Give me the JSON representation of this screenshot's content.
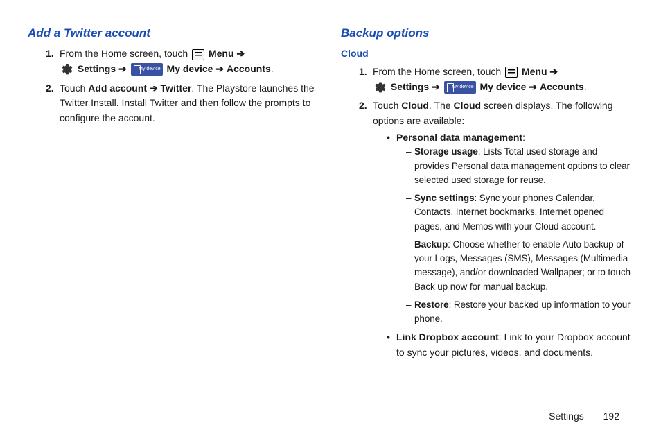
{
  "left": {
    "title": "Add a Twitter account",
    "step1_a": "From the Home screen, touch ",
    "menu": "Menu",
    "arrow": "➔",
    "settings": "Settings",
    "mydevice": "My device",
    "accounts": "Accounts",
    "step2_a": "Touch ",
    "step2_b": "Add account ➔ Twitter",
    "step2_c": ". The Playstore launches the Twitter Install. Install Twitter and then follow the prompts to configure the account."
  },
  "right": {
    "title": "Backup options",
    "subhead": "Cloud",
    "step1_a": "From the Home screen, touch ",
    "menu": "Menu",
    "arrow": "➔",
    "settings": "Settings",
    "mydevice": "My device",
    "accounts": "Accounts",
    "step2_a": "Touch ",
    "step2_b": "Cloud",
    "step2_c": ". The ",
    "step2_d": "Cloud",
    "step2_e": " screen displays. The following options are available:",
    "pdm": "Personal data management",
    "storage_b": "Storage usage",
    "storage_t": ": Lists Total used storage and provides Personal data management options to clear selected used storage for reuse.",
    "sync_b": "Sync settings",
    "sync_t": ": Sync your phones Calendar, Contacts, Internet bookmarks, Internet opened pages, and Memos with your Cloud account.",
    "backup_b": "Backup",
    "backup_t": ": Choose whether to enable Auto backup of your Logs, Messages (SMS), Messages (Multimedia message), and/or downloaded Wallpaper; or to touch Back up now for manual backup.",
    "restore_b": "Restore",
    "restore_t": ": Restore your backed up information to your phone.",
    "dropbox_b": "Link Dropbox account",
    "dropbox_t": ": Link to your Dropbox account to sync your pictures, videos, and documents."
  },
  "footer": {
    "section": "Settings",
    "page": "192"
  },
  "icons": {
    "mydevice_label": "My device"
  }
}
